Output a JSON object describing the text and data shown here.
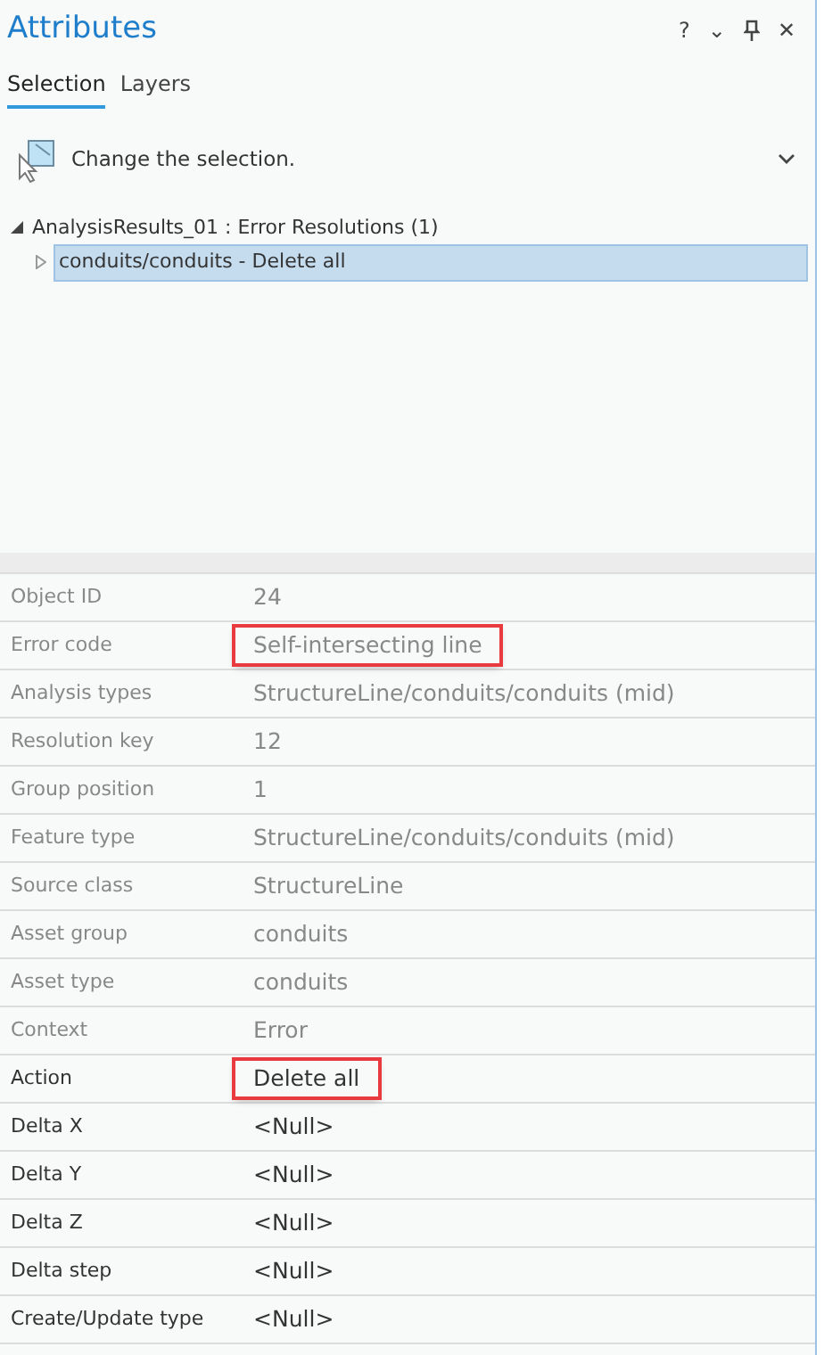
{
  "window": {
    "title": "Attributes",
    "controls": [
      "?",
      "⌄",
      "✕"
    ]
  },
  "tabs": [
    {
      "label": "Selection",
      "selected": true
    },
    {
      "label": "Layers",
      "selected": false
    }
  ],
  "prompt": {
    "text": "Change the selection.",
    "expanded": false
  },
  "tree": [
    {
      "label": "AnalysisResults_01 : Error Resolutions (1)",
      "expanded": true,
      "selected": false,
      "children": [
        {
          "label": "conduits/conduits - Delete all",
          "expanded": false,
          "selected": true
        }
      ]
    }
  ],
  "attributes": [
    {
      "field": "Object ID",
      "value": "24",
      "disabled": true,
      "highlighted": false
    },
    {
      "field": "Error code",
      "value": "Self-intersecting line",
      "disabled": true,
      "highlighted": true
    },
    {
      "field": "Analysis types",
      "value": "StructureLine/conduits/conduits (mid)",
      "disabled": true,
      "highlighted": false
    },
    {
      "field": "Resolution key",
      "value": "12",
      "disabled": true,
      "highlighted": false
    },
    {
      "field": "Group position",
      "value": "1",
      "disabled": true,
      "highlighted": false
    },
    {
      "field": "Feature type",
      "value": "StructureLine/conduits/conduits (mid)",
      "disabled": true,
      "highlighted": false
    },
    {
      "field": "Source class",
      "value": "StructureLine",
      "disabled": true,
      "highlighted": false
    },
    {
      "field": "Asset group",
      "value": "conduits",
      "disabled": true,
      "highlighted": false
    },
    {
      "field": "Asset type",
      "value": "conduits",
      "disabled": true,
      "highlighted": false
    },
    {
      "field": "Context",
      "value": "Error",
      "disabled": true,
      "highlighted": false
    },
    {
      "field": "Action",
      "value": "Delete all",
      "disabled": false,
      "highlighted": true
    },
    {
      "field": "Delta X",
      "value": "<Null>",
      "disabled": false,
      "highlighted": false
    },
    {
      "field": "Delta Y",
      "value": "<Null>",
      "disabled": false,
      "highlighted": false
    },
    {
      "field": "Delta Z",
      "value": "<Null>",
      "disabled": false,
      "highlighted": false
    },
    {
      "field": "Delta step",
      "value": "<Null>",
      "disabled": false,
      "highlighted": false
    },
    {
      "field": "Create/Update type",
      "value": "<Null>",
      "disabled": false,
      "highlighted": false
    }
  ]
}
